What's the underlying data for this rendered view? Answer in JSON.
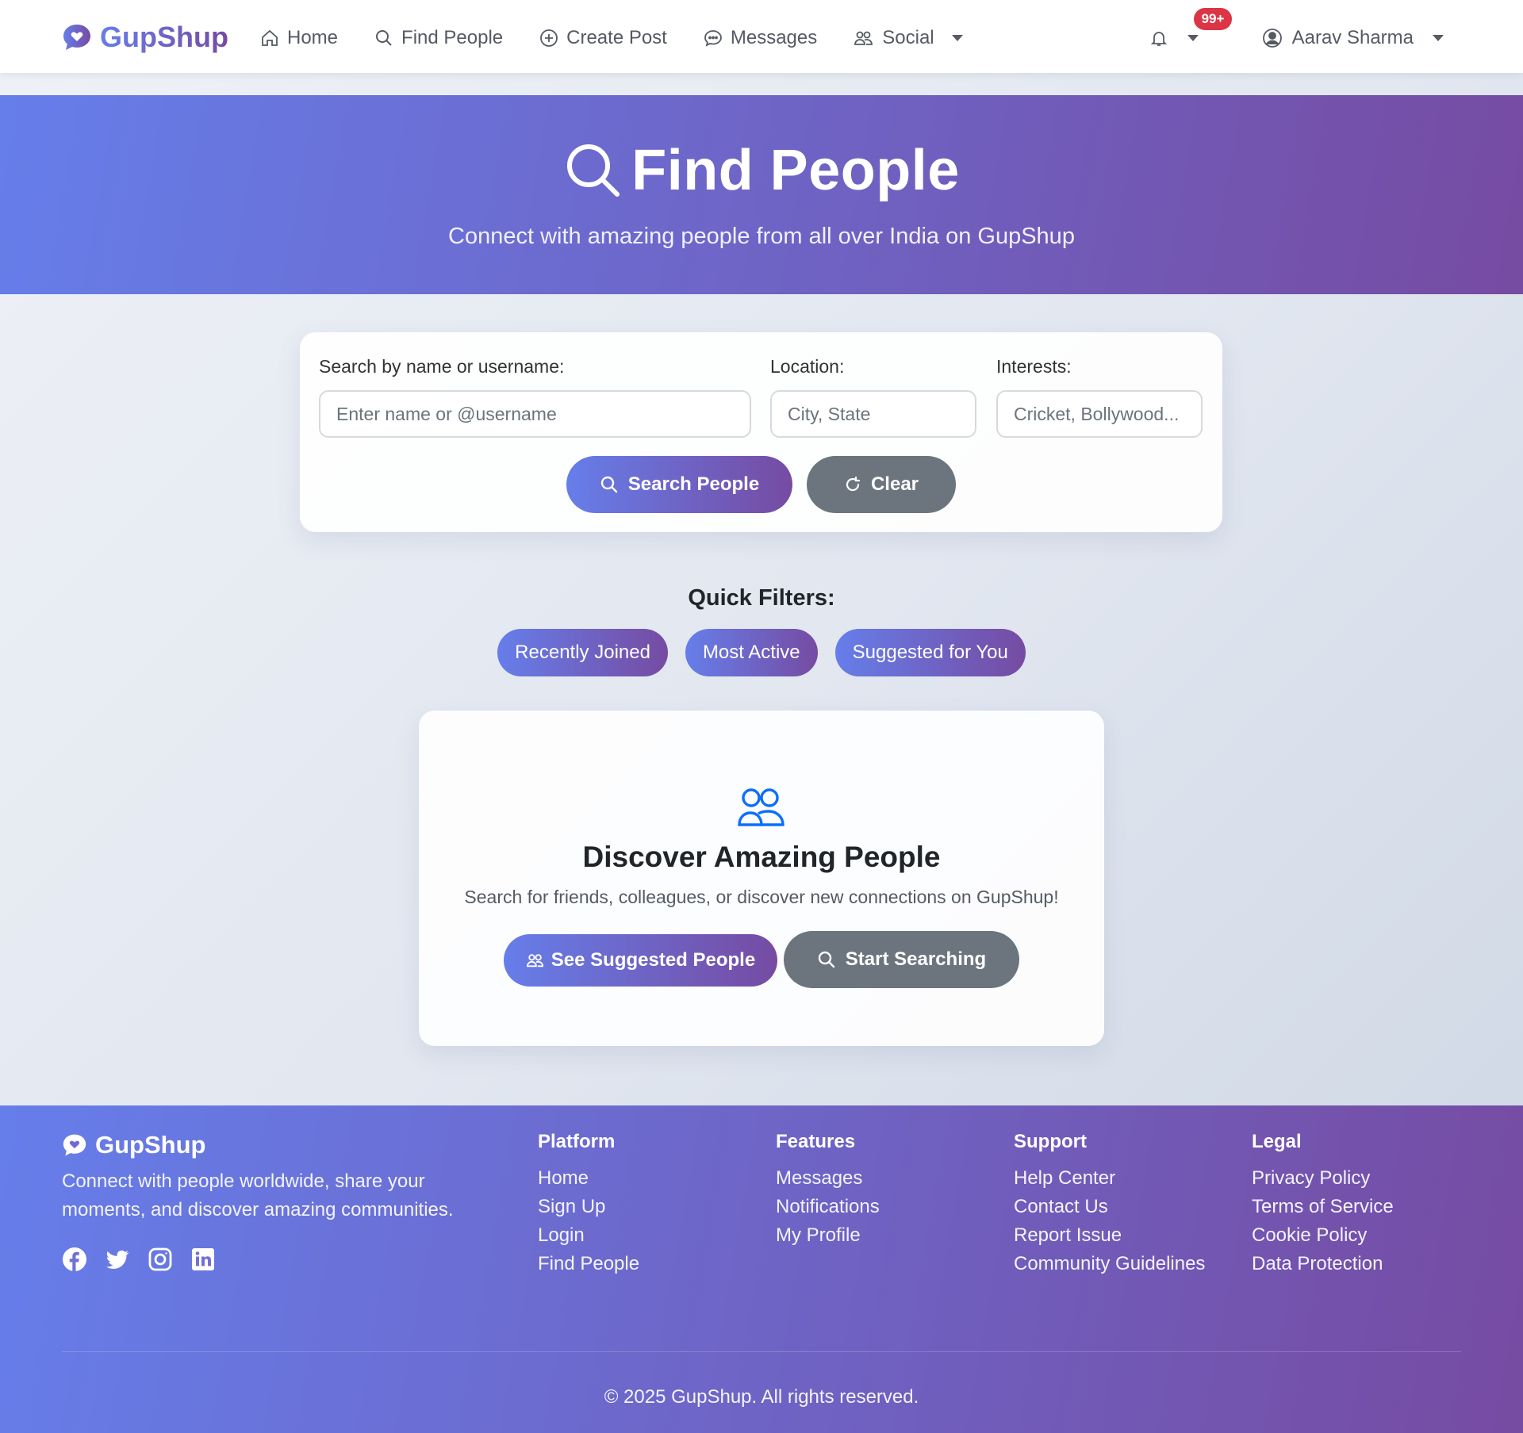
{
  "colors": {
    "gradient_start": "#667eea",
    "gradient_end": "#764ba2",
    "secondary": "#6c757d",
    "badge": "#dc3545",
    "icon_blue": "#0d6efd"
  },
  "navbar": {
    "brand": "GupShup",
    "brand_icon": "chat-heart-icon",
    "links": [
      {
        "label": "Home",
        "icon": "house-icon"
      },
      {
        "label": "Find People",
        "icon": "search-icon"
      },
      {
        "label": "Create Post",
        "icon": "plus-circle-icon"
      },
      {
        "label": "Messages",
        "icon": "chat-dots-icon"
      },
      {
        "label": "Social",
        "icon": "people-icon"
      }
    ],
    "notification_badge": "99+",
    "user_name": "Aarav Sharma"
  },
  "hero": {
    "title": "Find People",
    "subtitle": "Connect with amazing people from all over India on GupShup"
  },
  "search": {
    "name_label": "Search by name or username:",
    "name_placeholder": "Enter name or @username",
    "location_label": "Location:",
    "location_placeholder": "City, State",
    "interests_label": "Interests:",
    "interests_placeholder": "Cricket, Bollywood...",
    "search_button": "Search People",
    "clear_button": "Clear"
  },
  "quick_filters": {
    "title": "Quick Filters:",
    "chips": [
      "Recently Joined",
      "Most Active",
      "Suggested for You"
    ]
  },
  "discover": {
    "title": "Discover Amazing People",
    "subtitle": "Search for friends, colleagues, or discover new connections on GupShup!",
    "suggested_button": "See Suggested People",
    "start_button": "Start Searching"
  },
  "footer": {
    "brand": "GupShup",
    "description": "Connect with people worldwide, share your moments, and discover amazing communities.",
    "social_icons": [
      "facebook-icon",
      "twitter-icon",
      "instagram-icon",
      "linkedin-icon"
    ],
    "columns": [
      {
        "title": "Platform",
        "links": [
          "Home",
          "Sign Up",
          "Login",
          "Find People"
        ]
      },
      {
        "title": "Features",
        "links": [
          "Messages",
          "Notifications",
          "My Profile"
        ]
      },
      {
        "title": "Support",
        "links": [
          "Help Center",
          "Contact Us",
          "Report Issue",
          "Community Guidelines"
        ]
      },
      {
        "title": "Legal",
        "links": [
          "Privacy Policy",
          "Terms of Service",
          "Cookie Policy",
          "Data Protection"
        ]
      }
    ],
    "copyright": "© 2025 GupShup. All rights reserved."
  }
}
